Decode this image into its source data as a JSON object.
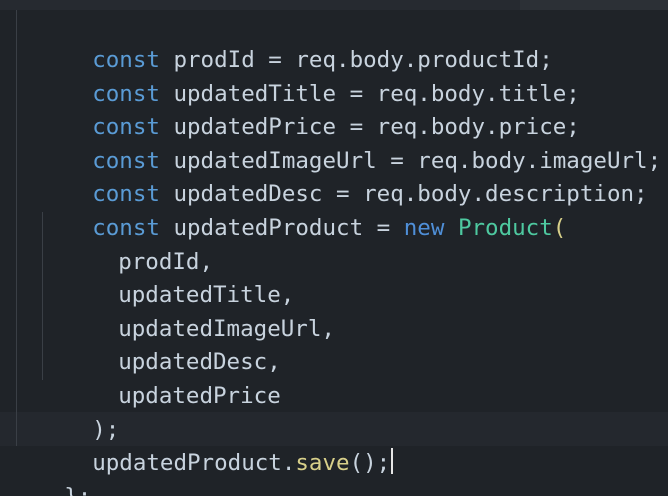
{
  "code": {
    "lines": [
      {
        "kw": "const",
        "rest": " prodId = req.body.productId;"
      },
      {
        "kw": "const",
        "rest": " updatedTitle = req.body.title;"
      },
      {
        "kw": "const",
        "rest": " updatedPrice = req.body.price;"
      },
      {
        "kw": "const",
        "rest": " updatedImageUrl = req.body.imageUrl;"
      },
      {
        "kw": "const",
        "rest": " updatedDesc = req.body.description;"
      },
      {
        "kw": "const",
        "rest": " updatedProduct = ",
        "new_kw": "new",
        "cls": "Product",
        "after": "("
      },
      {
        "text": "prodId,"
      },
      {
        "text": "updatedTitle,"
      },
      {
        "text": "updatedImageUrl,"
      },
      {
        "text": "updatedDesc,"
      },
      {
        "text": "updatedPrice"
      },
      {
        "text": ");"
      },
      {
        "obj": "updatedProduct.",
        "method": "save",
        "after": "();"
      },
      {
        "text": "};"
      }
    ]
  },
  "colors": {
    "background": "#1f2328",
    "keyword": "#5a9bd5",
    "class_name": "#4ec9a0",
    "method": "#d8d08a",
    "text": "#c8d3de"
  }
}
